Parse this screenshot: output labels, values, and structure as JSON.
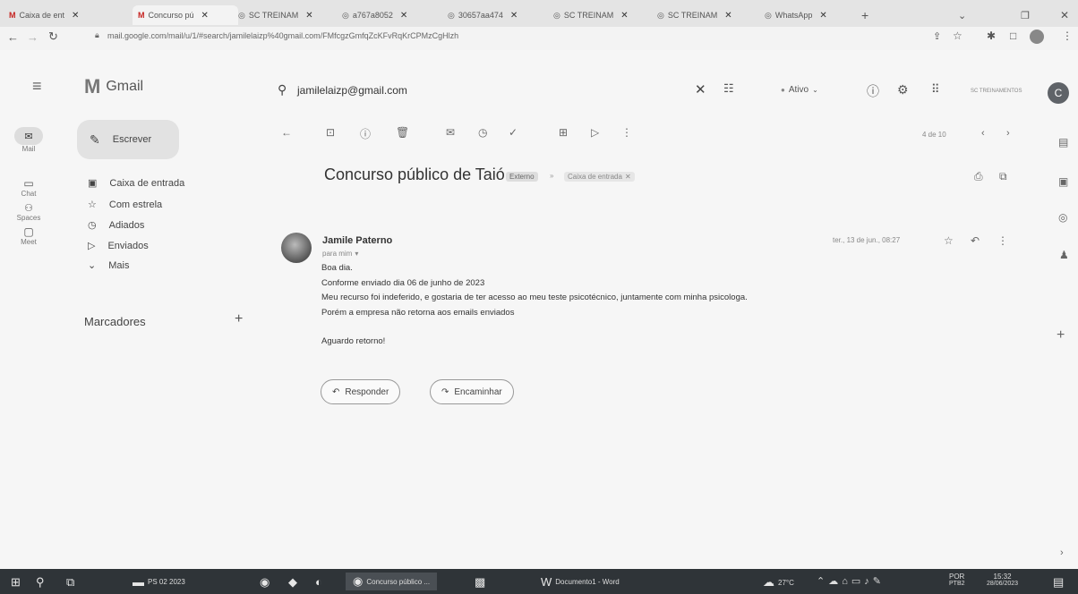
{
  "browser": {
    "tabs": [
      {
        "label": "Caixa de ent",
        "icon": "gmail-icon"
      },
      {
        "label": "Concurso pú",
        "icon": "gmail-icon"
      },
      {
        "label": "SC TREINAM",
        "icon": "globe-icon"
      },
      {
        "label": "a767a8052",
        "icon": "globe-icon"
      },
      {
        "label": "30657aa474",
        "icon": "globe-icon"
      },
      {
        "label": "SC TREINAM",
        "icon": "globe-icon"
      },
      {
        "label": "SC TREINAM",
        "icon": "globe-icon"
      },
      {
        "label": "WhatsApp",
        "icon": "globe-icon"
      }
    ],
    "new_tab": "+",
    "url": "mail.google.com/mail/u/1/#search/jamilelaizp%40gmail.com/FMfcgzGmfqZcKFvRqKrCPMzCgHlzh"
  },
  "gmail": {
    "brand": "Gmail",
    "search_value": "jamilelaizp@gmail.com",
    "status": "Ativo",
    "account_initial": "C",
    "account_org": "SC TREINAMENTOS",
    "rail": [
      {
        "label": "Mail",
        "icon": "mail-icon"
      },
      {
        "label": "Chat",
        "icon": "chat-icon"
      },
      {
        "label": "Spaces",
        "icon": "spaces-icon"
      },
      {
        "label": "Meet",
        "icon": "meet-icon"
      }
    ],
    "compose": "Escrever",
    "nav": [
      {
        "label": "Caixa de entrada",
        "icon": "inbox-icon"
      },
      {
        "label": "Com estrela",
        "icon": "star-icon"
      },
      {
        "label": "Adiados",
        "icon": "clock-icon"
      },
      {
        "label": "Enviados",
        "icon": "send-icon"
      },
      {
        "label": "Mais",
        "icon": "chevron-down-icon"
      }
    ],
    "labels_heading": "Marcadores",
    "pager": "4 de 10"
  },
  "email": {
    "subject": "Concurso público de Taió",
    "tag_external": "Externo",
    "tag_inbox": "Caixa de entrada",
    "sender": "Jamile Paterno",
    "recipient": "para mim",
    "date": "ter., 13 de jun., 08:27",
    "body": [
      "Boa dia.",
      "Conforme enviado dia 06 de junho de 2023",
      "Meu recurso foi indeferido, e gostaria de ter acesso ao meu teste psicotécnico, juntamente com minha psicologa.",
      "Porém a empresa não retorna aos emails enviados",
      "",
      "Aguardo retorno!"
    ],
    "reply": "Responder",
    "forward": "Encaminhar"
  },
  "taskbar": {
    "app1": "PS 02 2023",
    "app2": "Concurso público ...",
    "app3": "Documento1 - Word",
    "weather": "27°C",
    "lang": "POR",
    "lang2": "PTB2",
    "time": "15:32",
    "date": "28/06/2023"
  }
}
